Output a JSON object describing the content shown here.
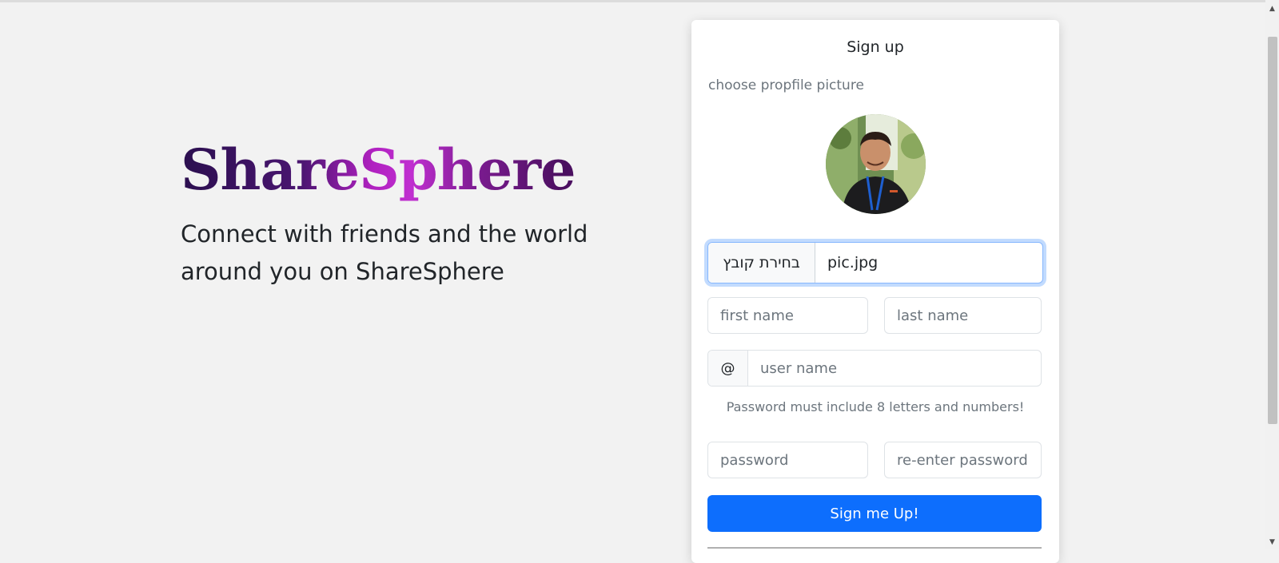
{
  "hero": {
    "brand": "ShareSphere",
    "tagline": "Connect with friends and the world around you on ShareSphere"
  },
  "signup": {
    "title": "Sign up",
    "picture_label": "choose propfile picture",
    "file_button": "בחירת קובץ",
    "file_name": "pic.jpg",
    "first_name_placeholder": "first name",
    "last_name_placeholder": "last name",
    "at_symbol": "@",
    "username_placeholder": "user name",
    "password_hint": "Password must include 8 letters and numbers!",
    "password_placeholder": "password",
    "reenter_placeholder": "re-enter password",
    "submit_label": "Sign me Up!"
  },
  "scrollbar": {
    "up_icon": "▲",
    "down_icon": "▼"
  }
}
